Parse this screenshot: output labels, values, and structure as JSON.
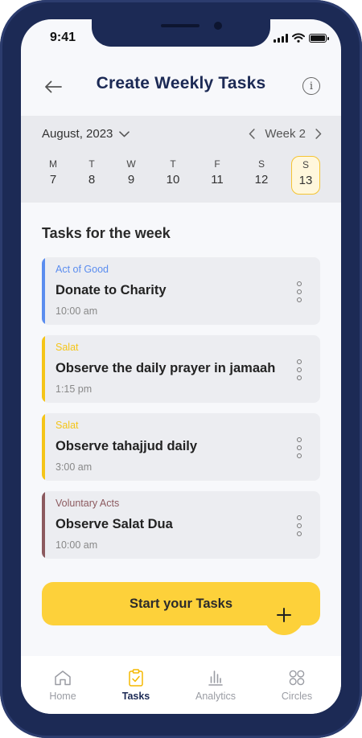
{
  "status_bar": {
    "time": "9:41"
  },
  "header": {
    "title": "Create Weekly Tasks",
    "back_icon": "arrow-left-icon",
    "info_icon": "info-icon"
  },
  "calendar": {
    "month_label": "August, 2023",
    "week_label": "Week 2",
    "days": [
      {
        "letter": "M",
        "date": "7"
      },
      {
        "letter": "T",
        "date": "8"
      },
      {
        "letter": "W",
        "date": "9"
      },
      {
        "letter": "T",
        "date": "10"
      },
      {
        "letter": "F",
        "date": "11"
      },
      {
        "letter": "S",
        "date": "12"
      },
      {
        "letter": "S",
        "date": "13"
      }
    ],
    "selected_date": "13"
  },
  "tasks_section": {
    "title": "Tasks for the week"
  },
  "tasks": [
    {
      "category": "Act of Good",
      "name": "Donate to Charity",
      "time": "10:00 am",
      "color": "#5b8def"
    },
    {
      "category": "Salat",
      "name": "Observe the daily prayer in jamaah",
      "time": "1:15 pm",
      "color": "#f5c518"
    },
    {
      "category": "Salat",
      "name": "Observe tahajjud daily",
      "time": "3:00 am",
      "color": "#f5c518"
    },
    {
      "category": "Voluntary Acts",
      "name": "Observe Salat Dua",
      "time": "10:00 am",
      "color": "#8c5a5f"
    }
  ],
  "actions": {
    "start_label": "Start your Tasks",
    "add_icon": "plus-icon"
  },
  "tabbar": {
    "items": [
      {
        "label": "Home",
        "icon": "home-icon"
      },
      {
        "label": "Tasks",
        "icon": "clipboard-check-icon"
      },
      {
        "label": "Analytics",
        "icon": "bar-chart-icon"
      },
      {
        "label": "Circles",
        "icon": "circles-icon"
      }
    ],
    "active": "Tasks"
  },
  "colors": {
    "brand": "#1c2a55",
    "accent": "#fdd13a"
  }
}
